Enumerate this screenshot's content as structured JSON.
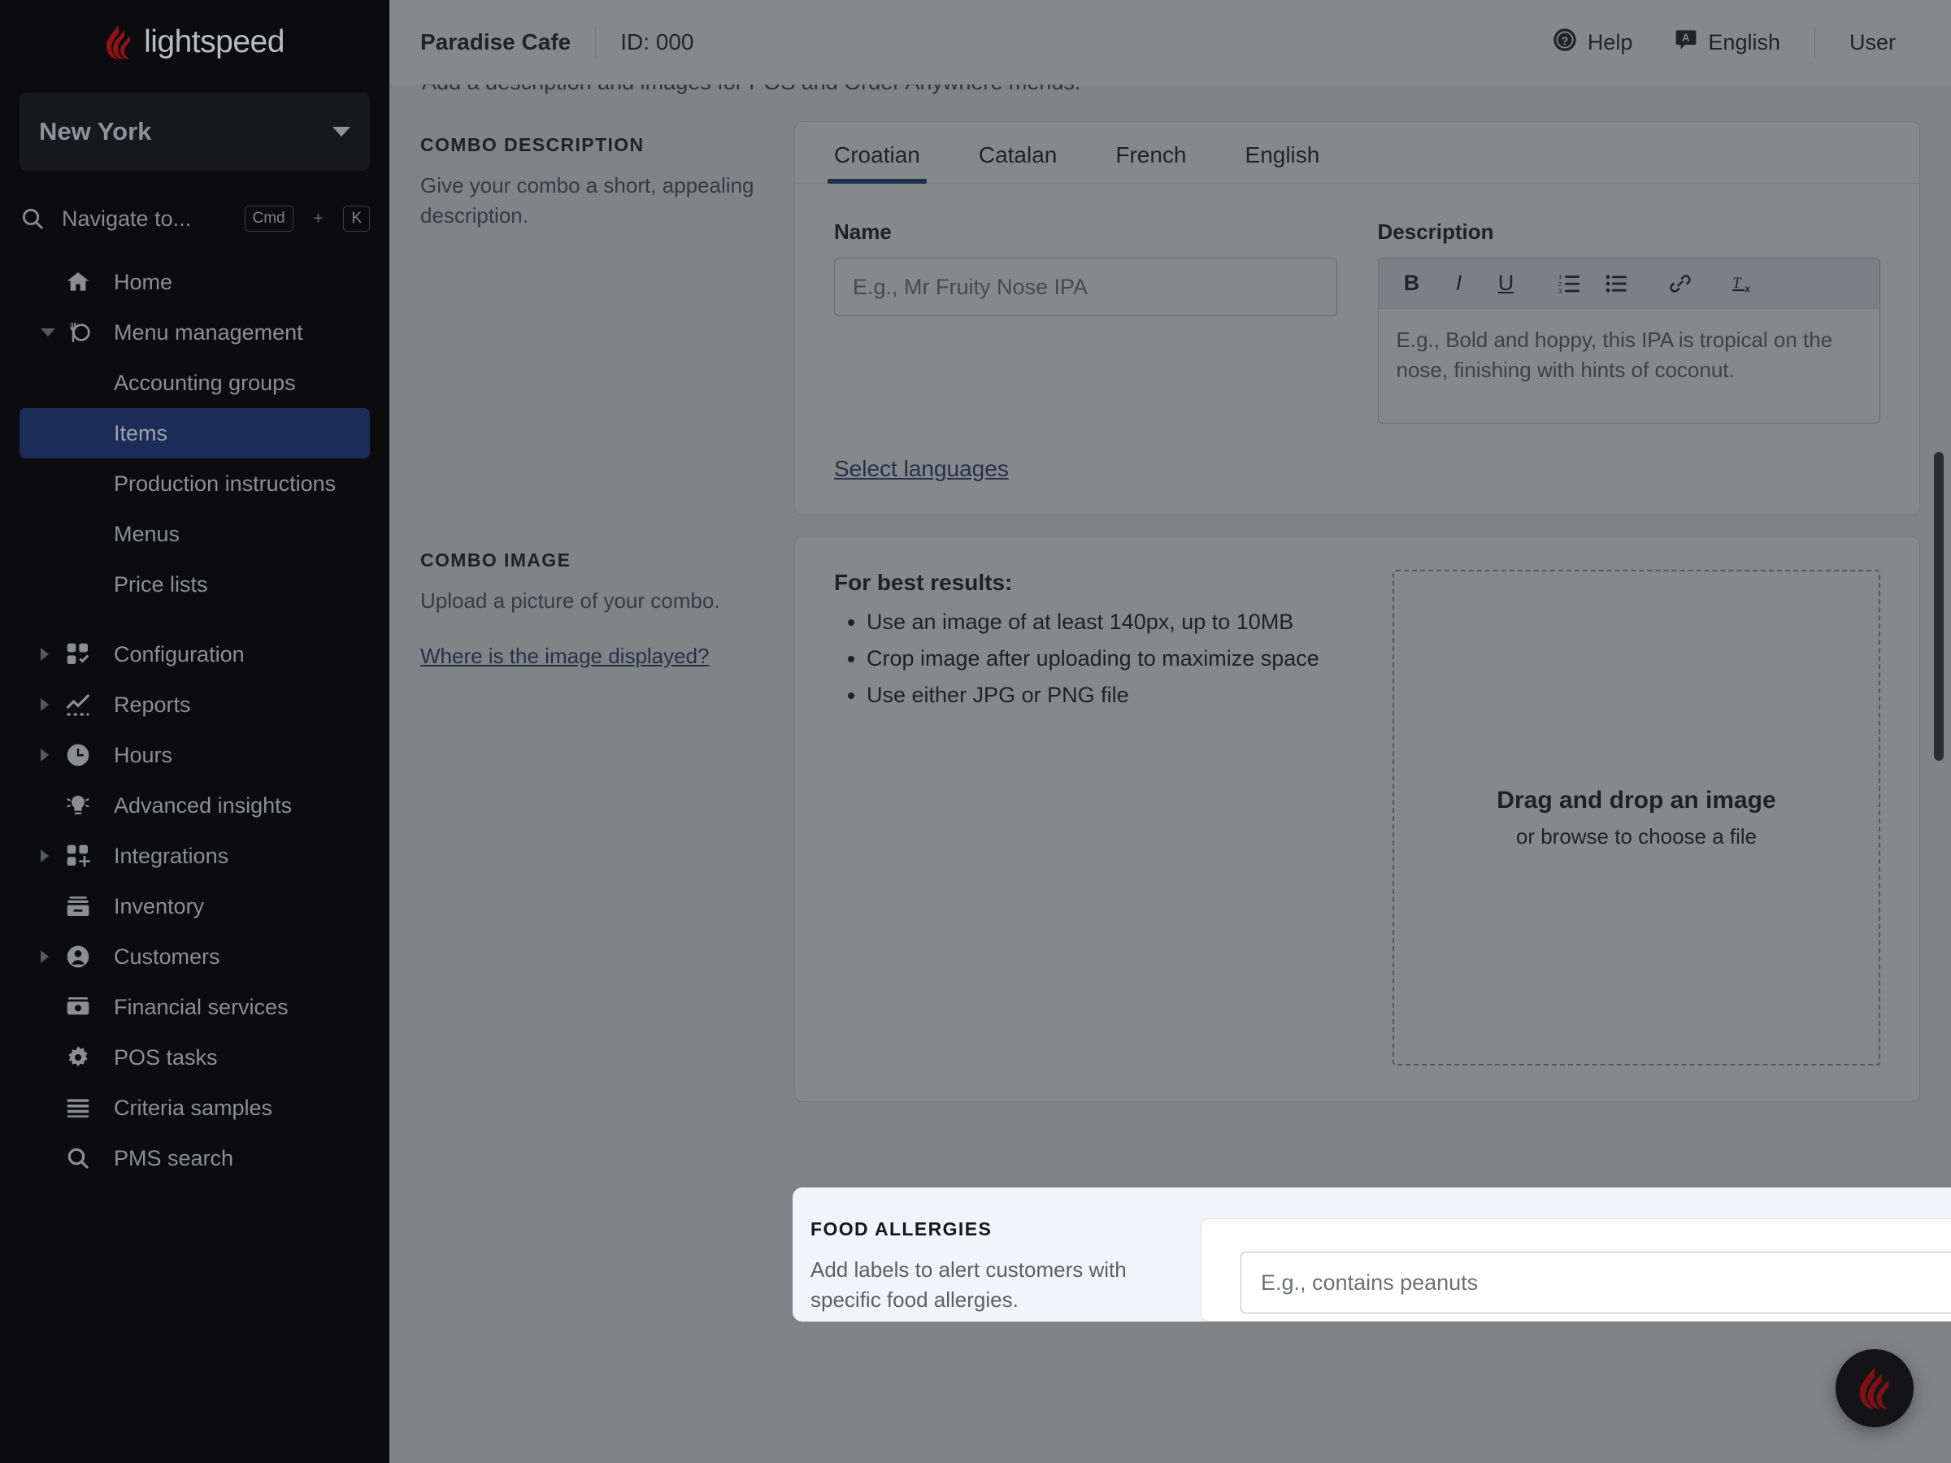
{
  "sidebar": {
    "brand": "lightspeed",
    "location": "New York",
    "search": {
      "placeholder": "Navigate to...",
      "key_mod": "Cmd",
      "key_plus": "+",
      "key_letter": "K"
    },
    "items": [
      {
        "label": "Home",
        "icon": "home-icon",
        "expandable": false,
        "expanded": false
      },
      {
        "label": "Menu management",
        "icon": "menu-management-icon",
        "expandable": true,
        "expanded": true
      },
      {
        "label": "Configuration",
        "icon": "configuration-icon",
        "expandable": true,
        "expanded": false
      },
      {
        "label": "Reports",
        "icon": "reports-icon",
        "expandable": true,
        "expanded": false
      },
      {
        "label": "Hours",
        "icon": "clock-icon",
        "expandable": true,
        "expanded": false
      },
      {
        "label": "Advanced insights",
        "icon": "lightbulb-icon",
        "expandable": false,
        "expanded": false
      },
      {
        "label": "Integrations",
        "icon": "integrations-icon",
        "expandable": true,
        "expanded": false
      },
      {
        "label": "Inventory",
        "icon": "inventory-icon",
        "expandable": false,
        "expanded": false
      },
      {
        "label": "Customers",
        "icon": "customers-icon",
        "expandable": true,
        "expanded": false
      },
      {
        "label": "Financial services",
        "icon": "money-icon",
        "expandable": false,
        "expanded": false
      },
      {
        "label": "POS tasks",
        "icon": "gear-icon",
        "expandable": false,
        "expanded": false
      },
      {
        "label": "Criteria samples",
        "icon": "list-lines-icon",
        "expandable": false,
        "expanded": false
      },
      {
        "label": "PMS search",
        "icon": "search-icon",
        "expandable": false,
        "expanded": false
      }
    ],
    "submenu": [
      {
        "label": "Accounting groups",
        "active": false
      },
      {
        "label": "Items",
        "active": true
      },
      {
        "label": "Production instructions",
        "active": false
      },
      {
        "label": "Menus",
        "active": false
      },
      {
        "label": "Price lists",
        "active": false
      }
    ]
  },
  "topbar": {
    "venue": "Paradise Cafe",
    "id": "ID: 000",
    "help": "Help",
    "language": "English",
    "user": "User"
  },
  "content": {
    "intro": "Add a description and images for POS and Order Anywhere menus.",
    "combo_description": {
      "title": "COMBO DESCRIPTION",
      "desc": "Give your combo a short, appealing description.",
      "tabs": [
        {
          "label": "Croatian",
          "active": true
        },
        {
          "label": "Catalan",
          "active": false
        },
        {
          "label": "French",
          "active": false
        },
        {
          "label": "English",
          "active": false
        }
      ],
      "name_label": "Name",
      "name_placeholder": "E.g., Mr Fruity Nose IPA",
      "name_value": "",
      "description_label": "Description",
      "description_placeholder": "E.g., Bold and hoppy, this IPA is tropical on the nose, finishing with hints of coconut.",
      "toolbar": [
        {
          "name": "bold-icon",
          "glyph": "B"
        },
        {
          "name": "italic-icon",
          "glyph": "I"
        },
        {
          "name": "underline-icon",
          "glyph": "U"
        },
        {
          "name": "numbered-list-icon",
          "glyph": ""
        },
        {
          "name": "bullet-list-icon",
          "glyph": ""
        },
        {
          "name": "link-icon",
          "glyph": ""
        },
        {
          "name": "clear-formatting-icon",
          "glyph": ""
        }
      ],
      "select_languages_link": "Select languages"
    },
    "combo_image": {
      "title": "COMBO IMAGE",
      "desc": "Upload a picture of your combo.",
      "link": "Where is the image displayed?",
      "tips_title": "For best results:",
      "tips": [
        "Use an image of at least 140px, up to 10MB",
        "Crop image after uploading to maximize space",
        "Use either JPG or PNG file"
      ],
      "dropzone_title": "Drag and drop an image",
      "dropzone_sub": "or browse to choose a file"
    },
    "food_allergies": {
      "title": "FOOD ALLERGIES",
      "desc": "Add labels to alert customers with specific food allergies.",
      "select_placeholder": "E.g., contains peanuts",
      "select_value": ""
    }
  },
  "colors": {
    "sidebar_bg": "#0c0c0e",
    "sidebar_active": "#1a2c57",
    "brand_red": "#8f1318",
    "link_blue": "#1c3a73",
    "tab_underline": "#1c3a73",
    "spotlight_bg": "#f1f4f8",
    "dim_overlay": "rgba(40,42,46,0.56)"
  }
}
